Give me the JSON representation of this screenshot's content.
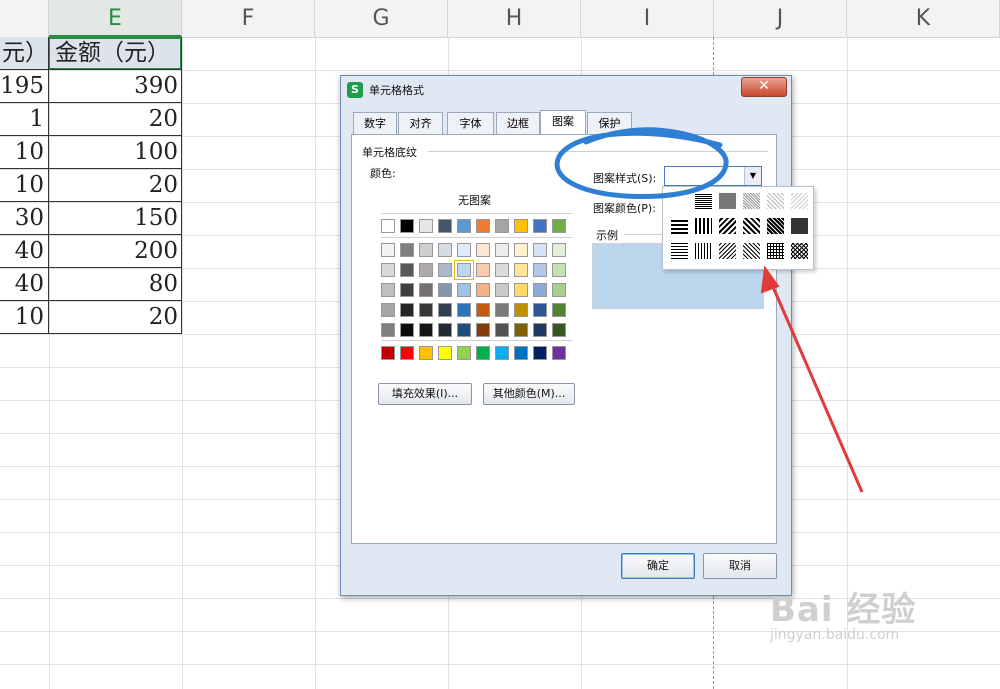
{
  "sheet": {
    "columns": [
      "E",
      "F",
      "G",
      "H",
      "I",
      "J",
      "K"
    ],
    "header_cells": [
      "元）",
      "金额（元）"
    ],
    "rows": [
      [
        "195",
        "390"
      ],
      [
        "1",
        "20"
      ],
      [
        "10",
        "100"
      ],
      [
        "10",
        "20"
      ],
      [
        "30",
        "150"
      ],
      [
        "40",
        "200"
      ],
      [
        "40",
        "80"
      ],
      [
        "10",
        "20"
      ]
    ]
  },
  "dialog": {
    "title": "单元格格式",
    "app_icon": "S",
    "close_glyph": "✕",
    "tabs": [
      "数字",
      "对齐",
      "字体",
      "边框",
      "图案",
      "保护"
    ],
    "active_tab": "图案",
    "section_title": "单元格底纹",
    "color_label": "颜色:",
    "no_pattern": "无图案",
    "pattern_style_label": "图案样式(S):",
    "pattern_color_label": "图案颜色(P):",
    "sample_label": "示例",
    "fill_effects_button": "填充效果(I)...",
    "more_colors_button": "其他颜色(M)...",
    "ok_button": "确定",
    "cancel_button": "取消",
    "sample_color": "#bcd6ee",
    "palette_top": [
      "#ffffff",
      "#000000",
      "#e7e6e6",
      "#44546a",
      "#5b9bd5",
      "#ed7d31",
      "#a5a5a5",
      "#ffc000",
      "#4472c4",
      "#70ad47"
    ],
    "palette_shades": [
      [
        "#f2f2f2",
        "#7f7f7f",
        "#d0cece",
        "#d6dce4",
        "#deebf6",
        "#fbe5d5",
        "#ededed",
        "#fff2cc",
        "#dae3f3",
        "#e2efd9"
      ],
      [
        "#d8d8d8",
        "#595959",
        "#aeaaaa",
        "#adb9ca",
        "#bdd7ee",
        "#f8cbad",
        "#dbdbdb",
        "#ffe598",
        "#b4c6e7",
        "#c5e0b3"
      ],
      [
        "#bfbfbf",
        "#3f3f3f",
        "#757070",
        "#8496b0",
        "#9dc3e6",
        "#f4b183",
        "#c9c9c9",
        "#ffd965",
        "#8eaadb",
        "#a8d08d"
      ],
      [
        "#a5a5a5",
        "#262626",
        "#3a3838",
        "#323f4f",
        "#2e75b5",
        "#c55a11",
        "#7b7b7b",
        "#bf9000",
        "#2f5496",
        "#538135"
      ],
      [
        "#7f7f7f",
        "#0c0c0c",
        "#171616",
        "#222a35",
        "#1e4e79",
        "#833c0b",
        "#525252",
        "#7f6000",
        "#1f3864",
        "#375623"
      ]
    ],
    "palette_standard": [
      "#c00000",
      "#ff0000",
      "#ffc000",
      "#ffff00",
      "#92d050",
      "#00b050",
      "#00b0f0",
      "#0070c0",
      "#002060",
      "#7030a0"
    ]
  },
  "watermark": {
    "main": "Bai 经验",
    "sub": "jingyan.baidu.com"
  }
}
